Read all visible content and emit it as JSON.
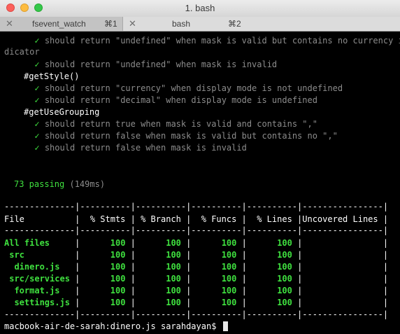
{
  "window": {
    "title": "1. bash"
  },
  "tabs": [
    {
      "close": "✕",
      "label": "fsevent_watch",
      "shortcut": "⌘1"
    },
    {
      "close": "✕",
      "label": "bash",
      "shortcut": "⌘2"
    }
  ],
  "output": {
    "test_lines": [
      {
        "check": "✓",
        "text": "should return \"undefined\" when mask is valid but contains no currency in"
      },
      {
        "text": "dicator"
      },
      {
        "check": "✓",
        "text": "should return \"undefined\" when mask is invalid"
      },
      {
        "text": "#getStyle()"
      },
      {
        "check": "✓",
        "text": "should return \"currency\" when display mode is not undefined"
      },
      {
        "check": "✓",
        "text": "should return \"decimal\" when display mode is undefined"
      },
      {
        "text": "#getUseGrouping"
      },
      {
        "check": "✓",
        "text": "should return true when mask is valid and contains \",\""
      },
      {
        "check": "✓",
        "text": "should return false when mask is valid but contains no \",\""
      },
      {
        "check": "✓",
        "text": "should return false when mask is invalid"
      }
    ],
    "summary": {
      "count": "73 passing",
      "time": "(149ms)"
    },
    "coverage": {
      "separator": "--------------|----------|----------|----------|----------|----------------|",
      "header": "File          |  % Stmts | % Branch |  % Funcs |  % Lines |Uncovered Lines |",
      "rows": [
        {
          "name": "All files",
          "stmts": "100",
          "branch": "100",
          "funcs": "100",
          "lines": "100",
          "uncovered": ""
        },
        {
          "name": " src",
          "stmts": "100",
          "branch": "100",
          "funcs": "100",
          "lines": "100",
          "uncovered": ""
        },
        {
          "name": "  dinero.js",
          "stmts": "100",
          "branch": "100",
          "funcs": "100",
          "lines": "100",
          "uncovered": ""
        },
        {
          "name": " src/services",
          "stmts": "100",
          "branch": "100",
          "funcs": "100",
          "lines": "100",
          "uncovered": ""
        },
        {
          "name": "  format.js",
          "stmts": "100",
          "branch": "100",
          "funcs": "100",
          "lines": "100",
          "uncovered": ""
        },
        {
          "name": "  settings.js",
          "stmts": "100",
          "branch": "100",
          "funcs": "100",
          "lines": "100",
          "uncovered": ""
        }
      ]
    },
    "prompt": "macbook-air-de-sarah:dinero.js sarahdayan$ "
  }
}
